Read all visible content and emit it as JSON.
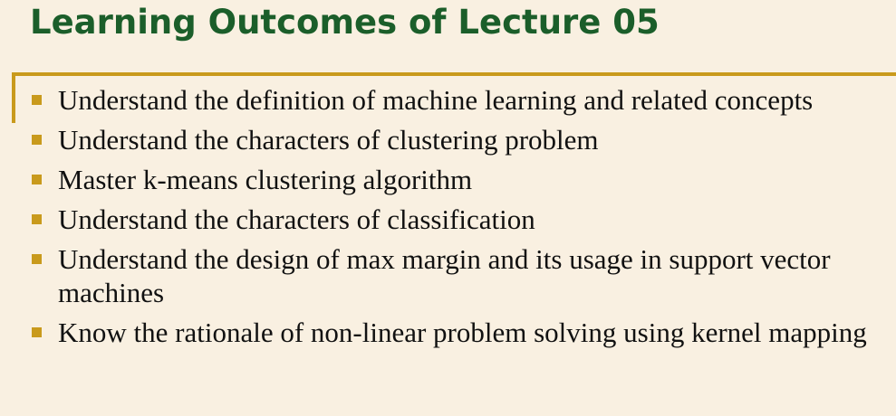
{
  "slide": {
    "title": "Learning Outcomes of Lecture 05"
  },
  "colors": {
    "background": "#f9f0e1",
    "title": "#1b5e2a",
    "accent": "#c99a1c",
    "text": "#111111"
  },
  "outcomes": [
    {
      "text": "Understand the definition of machine learning and related concepts"
    },
    {
      "text": "Understand the characters of clustering problem"
    },
    {
      "text": "Master k-means clustering algorithm"
    },
    {
      "text": "Understand the characters of classification"
    },
    {
      "text": "Understand the design of max margin and its usage in support vector machines"
    },
    {
      "text": "Know the rationale of non-linear problem solving using kernel mapping"
    }
  ]
}
